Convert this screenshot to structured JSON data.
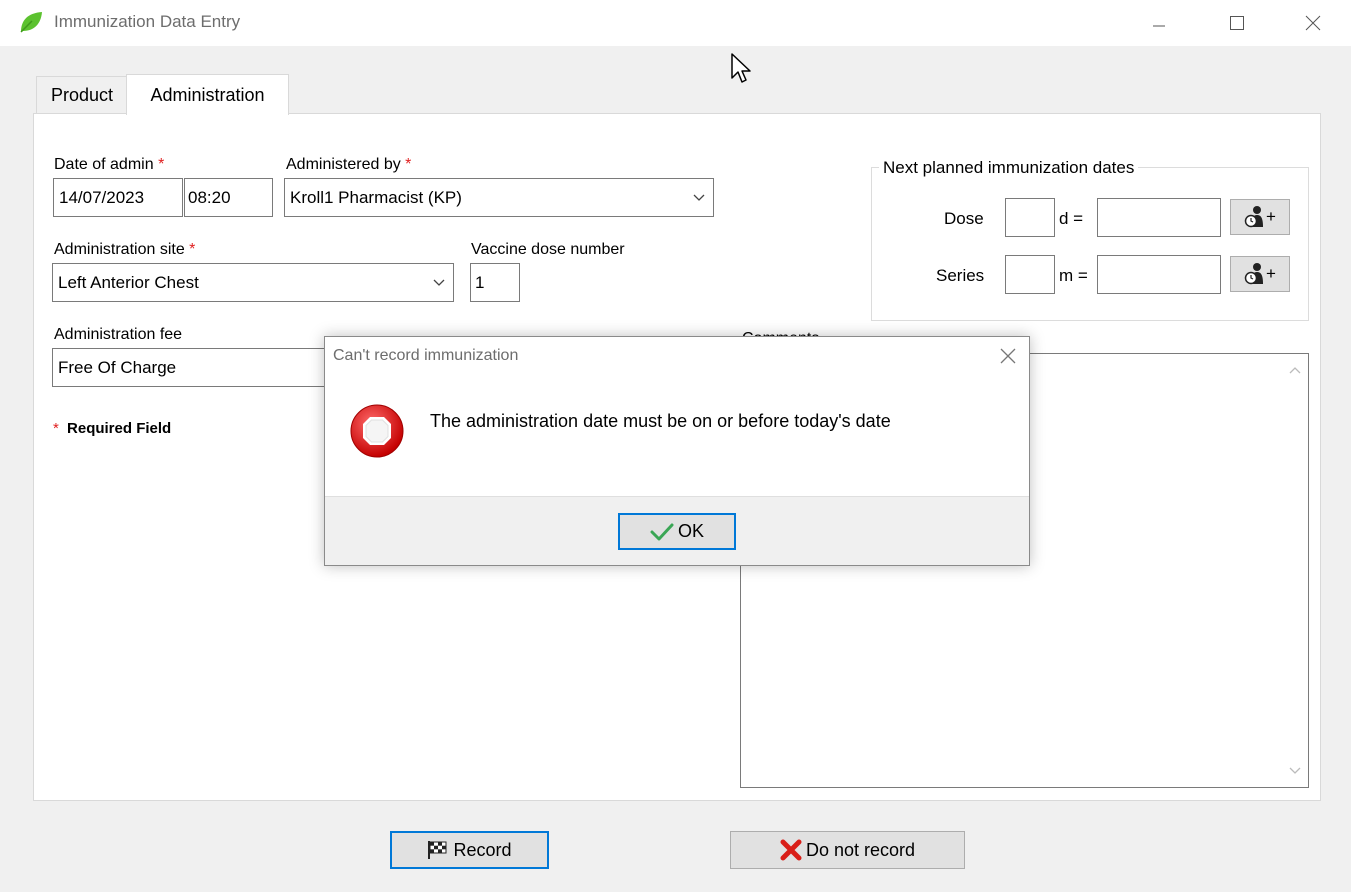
{
  "window": {
    "title": "Immunization Data Entry"
  },
  "tabs": [
    {
      "label": "Product"
    },
    {
      "label": "Administration"
    }
  ],
  "form": {
    "date_label": "Date of admin",
    "date_value": "14/07/2023",
    "time_value": "08:20",
    "admin_by_label": "Administered by",
    "admin_by_value": "Kroll1 Pharmacist (KP)",
    "site_label": "Administration site",
    "site_value": "Left Anterior Chest",
    "dose_number_label": "Vaccine dose number",
    "dose_number_value": "1",
    "fee_label": "Administration fee",
    "fee_value": "Free Of Charge",
    "required_marker": "*",
    "required_note": "Required Field"
  },
  "next_planned": {
    "title": "Next planned immunization dates",
    "dose_label": "Dose",
    "dose_value": "",
    "dose_unit": "d =",
    "dose_date": "",
    "series_label": "Series",
    "series_value": "",
    "series_unit": "m =",
    "series_date": "",
    "add_button_label": "+"
  },
  "comments": {
    "label": "Comments",
    "value": ""
  },
  "buttons": {
    "record": "Record",
    "do_not_record": "Do not record"
  },
  "dialog": {
    "title": "Can't record immunization",
    "message": "The administration date must be on or before today's date",
    "ok": "OK"
  },
  "colors": {
    "accent": "#0078d7",
    "required": "#e02020",
    "error_icon": "#e81123",
    "ok_check": "#3aa655"
  }
}
